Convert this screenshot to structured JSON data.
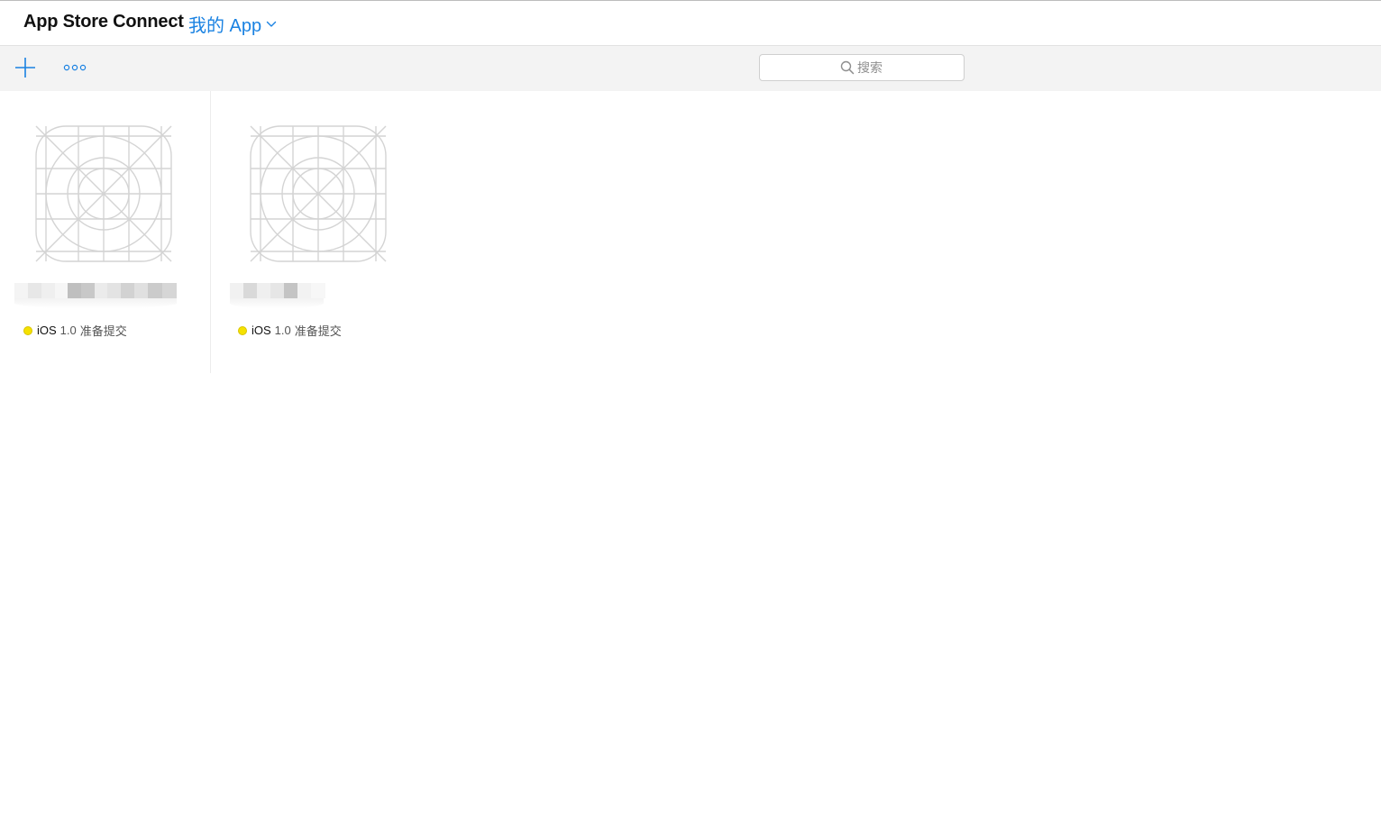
{
  "header": {
    "brand": "App Store Connect",
    "section_label": "我的 App",
    "section_icon": "chevron-down-icon",
    "accent_color": "#1a82e2"
  },
  "toolbar": {
    "add_icon": "plus-icon",
    "more_icon": "ellipsis-icon",
    "search": {
      "placeholder": "搜索",
      "value": "",
      "icon": "search-icon"
    }
  },
  "apps": [
    {
      "name": "",
      "name_redacted": true,
      "icon": "app-placeholder-icon",
      "status": {
        "color": "#f5e100",
        "platform": "iOS",
        "version": "1.0",
        "state": "准备提交"
      }
    },
    {
      "name": "",
      "name_redacted": true,
      "icon": "app-placeholder-icon",
      "status": {
        "color": "#f5e100",
        "platform": "iOS",
        "version": "1.0",
        "state": "准备提交"
      }
    }
  ]
}
